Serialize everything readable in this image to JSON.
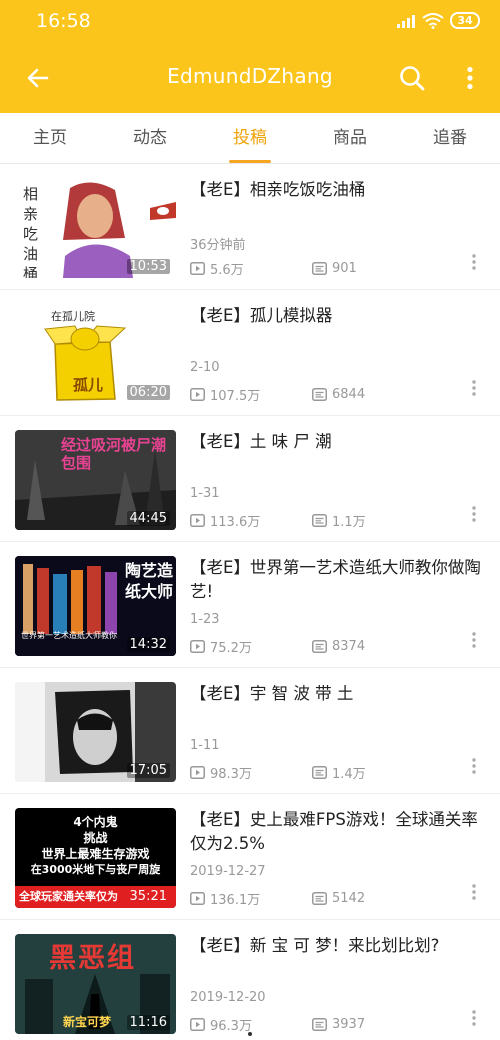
{
  "status": {
    "time": "16:58",
    "battery": "34"
  },
  "appbar": {
    "title": "EdmundDZhang"
  },
  "tabs": [
    {
      "label": "主页",
      "active": false
    },
    {
      "label": "动态",
      "active": false
    },
    {
      "label": "投稿",
      "active": true
    },
    {
      "label": "商品",
      "active": false
    },
    {
      "label": "追番",
      "active": false
    }
  ],
  "videos": [
    {
      "title": "【老E】相亲吃饭吃油桶",
      "date": "36分钟前",
      "views": "5.6万",
      "danmaku": "901",
      "duration": "10:53"
    },
    {
      "title": "【老E】孤儿模拟器",
      "date": "2-10",
      "views": "107.5万",
      "danmaku": "6844",
      "duration": "06:20"
    },
    {
      "title": "【老E】土 味 尸 潮",
      "date": "1-31",
      "views": "113.6万",
      "danmaku": "1.1万",
      "duration": "44:45"
    },
    {
      "title": "【老E】世界第一艺术造纸大师教你做陶艺!",
      "date": "1-23",
      "views": "75.2万",
      "danmaku": "8374",
      "duration": "14:32"
    },
    {
      "title": "【老E】宇 智 波 带 土",
      "date": "1-11",
      "views": "98.3万",
      "danmaku": "1.4万",
      "duration": "17:05"
    },
    {
      "title": "【老E】史上最难FPS游戏！全球通关率仅为2.5%",
      "date": "2019-12-27",
      "views": "136.1万",
      "danmaku": "5142",
      "duration": "35:21"
    },
    {
      "title": "【老E】新 宝 可 梦！来比划比划?",
      "date": "2019-12-20",
      "views": "96.3万",
      "danmaku": "3937",
      "duration": "11:16"
    }
  ],
  "thumb_text": {
    "v1": "相亲吃油桶",
    "v2_sign": "在孤儿院",
    "v2_box": "孤儿",
    "v3": "经过吸河被尸潮包围",
    "v4_big": "陶艺造纸大师",
    "v4_small": "世界第一艺术造纸大师教你",
    "v6": [
      "4个内鬼",
      "挑战",
      "世界上最难生存游戏",
      "在3000米地下与丧尸周旋",
      "全球玩家通关率仅为"
    ],
    "v7_big": "黑恶组",
    "v7_small": "新宝可梦"
  },
  "colors": {
    "accent": "#fbc51b",
    "tab_active": "#f0a30a"
  },
  "icons": {
    "back": "arrow-left-icon",
    "search": "search-icon",
    "more": "more-vert-icon",
    "views": "play-icon",
    "danmaku": "danmaku-icon",
    "wifi": "wifi-icon",
    "signal": "signal-icon"
  }
}
